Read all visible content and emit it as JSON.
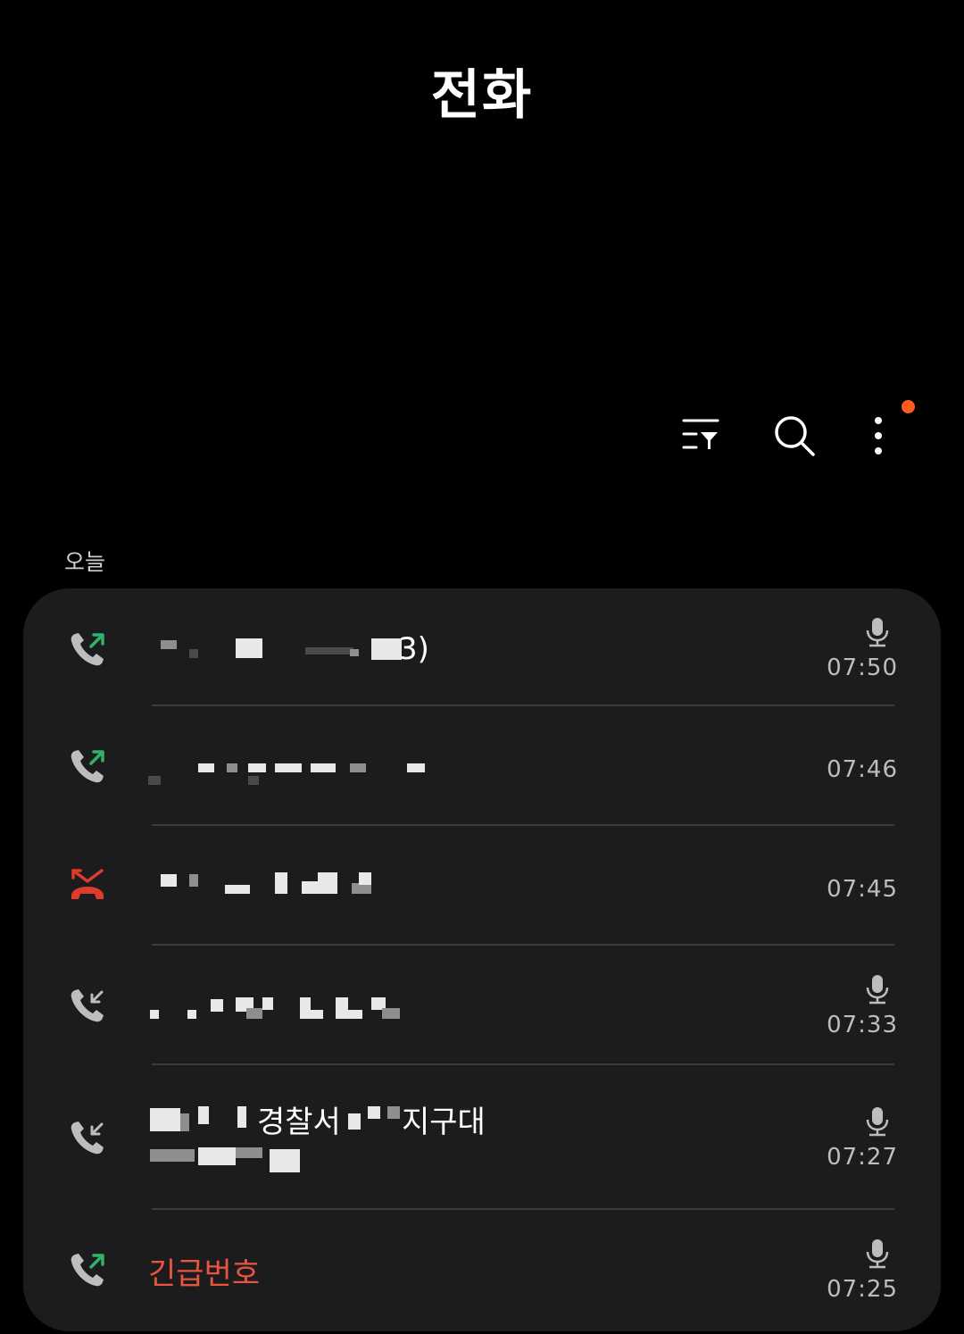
{
  "header": {
    "title": "전화"
  },
  "toolbar": {
    "filter_icon": "filter-list-icon",
    "search_icon": "search-icon",
    "more_icon": "more-vertical-icon",
    "notification_dot_color": "#ff5a1f"
  },
  "section": {
    "label": "오늘"
  },
  "colors": {
    "outgoing": "#2fb36b",
    "missed": "#e03a2f",
    "incoming": "#bdbdbd",
    "emergency_text": "#e8553f",
    "card_bg": "#1c1c1e"
  },
  "calls": [
    {
      "type": "outgoing",
      "icon": "outgoing-call-icon",
      "name_visible": "3)",
      "recorded": true,
      "time": "07:50"
    },
    {
      "type": "outgoing",
      "icon": "outgoing-call-icon",
      "name_visible": "",
      "recorded": false,
      "time": "07:46"
    },
    {
      "type": "missed",
      "icon": "missed-call-icon",
      "name_visible": "",
      "recorded": false,
      "time": "07:45"
    },
    {
      "type": "incoming",
      "icon": "incoming-call-icon",
      "name_visible": "",
      "recorded": true,
      "time": "07:33"
    },
    {
      "type": "incoming",
      "icon": "incoming-call-icon",
      "name_parts": [
        "경찰서",
        "지구대"
      ],
      "recorded": true,
      "time": "07:27"
    },
    {
      "type": "outgoing",
      "icon": "outgoing-call-icon",
      "name_visible": "긴급번호",
      "recorded": true,
      "time": "07:25"
    }
  ]
}
